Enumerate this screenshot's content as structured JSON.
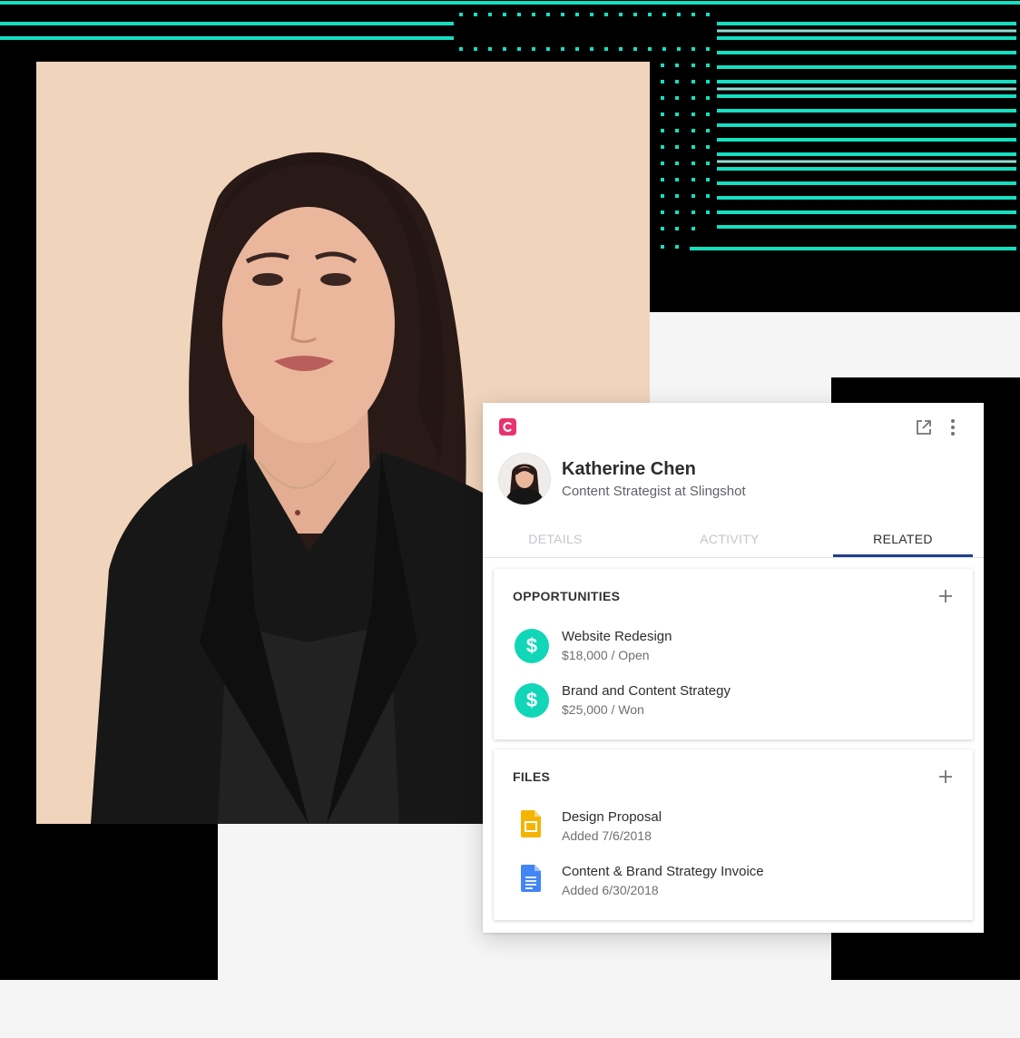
{
  "contact": {
    "name": "Katherine Chen",
    "title": "Content Strategist at Slingshot"
  },
  "tabs": [
    {
      "label": "DETAILS",
      "active": false
    },
    {
      "label": "ACTIVITY",
      "active": false
    },
    {
      "label": "RELATED",
      "active": true
    }
  ],
  "opportunities": {
    "heading": "OPPORTUNITIES",
    "items": [
      {
        "title": "Website Redesign",
        "subtitle": "$18,000 / Open",
        "icon": "dollar-icon"
      },
      {
        "title": "Brand and Content Strategy",
        "subtitle": "$25,000 / Won",
        "icon": "dollar-icon"
      }
    ]
  },
  "files": {
    "heading": "FILES",
    "items": [
      {
        "title": "Design Proposal",
        "subtitle": "Added 7/6/2018",
        "icon": "google-slides-icon"
      },
      {
        "title": "Content & Brand Strategy Invoice",
        "subtitle": "Added 6/30/2018",
        "icon": "google-docs-icon"
      }
    ]
  },
  "icons": {
    "dollar_glyph": "$",
    "app_logo": "copper-logo-icon",
    "open": "open-external-icon",
    "more": "more-vertical-icon",
    "add": "plus-icon"
  },
  "colors": {
    "accent_teal": "#11d6b8",
    "tab_underline": "#1f3e8c",
    "logo_pink": "#e8336d",
    "portrait_background": "#f1d4bc",
    "slides_yellow": "#f4b400",
    "docs_blue": "#4285f4"
  }
}
